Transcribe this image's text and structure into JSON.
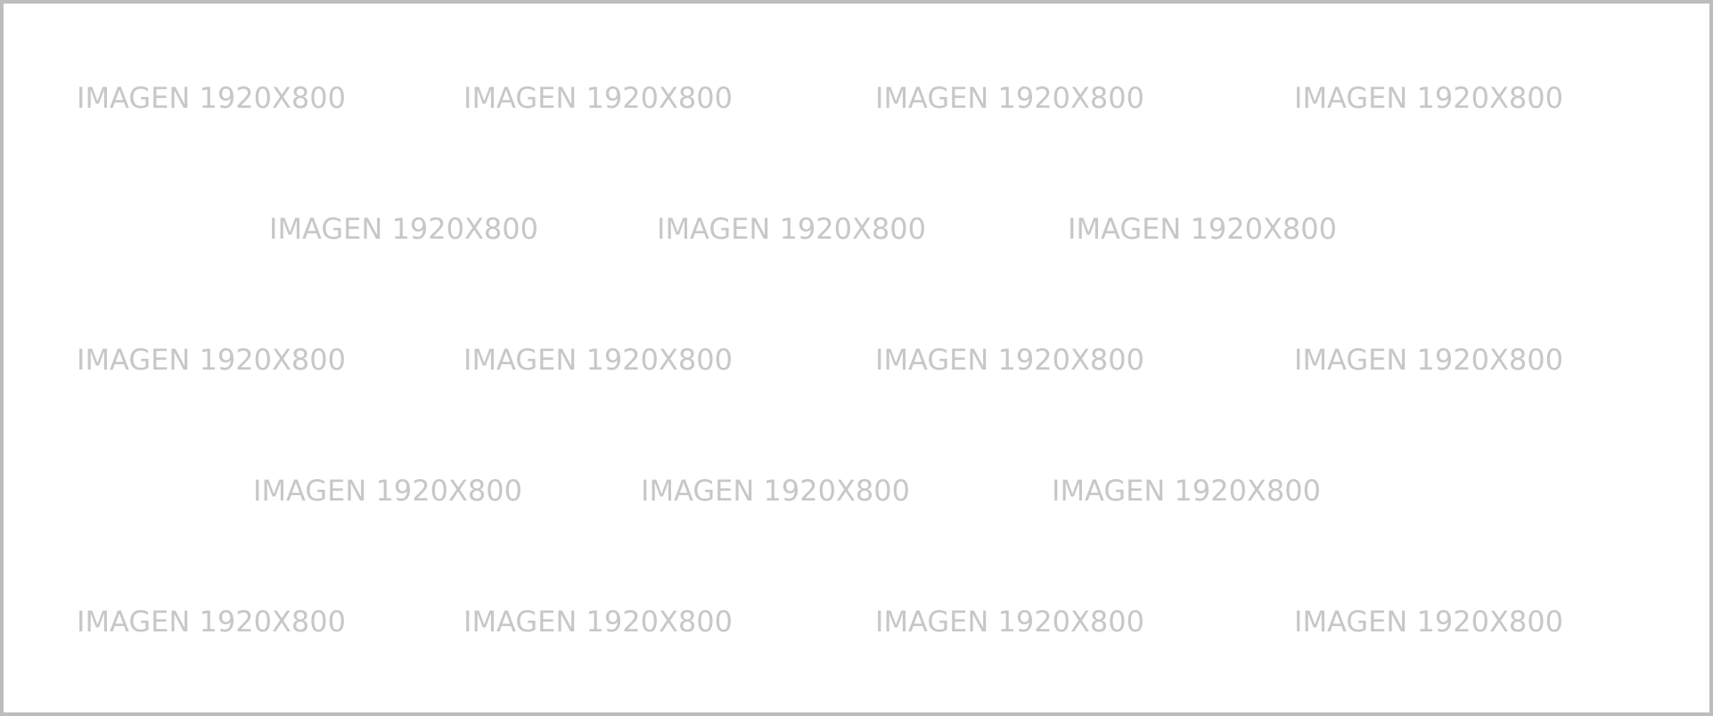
{
  "placeholder": {
    "text": "IMAGEN 1920X800",
    "text_color": "#c7c7c7",
    "border_color": "#bdbdbd",
    "background": "#ffffff"
  }
}
